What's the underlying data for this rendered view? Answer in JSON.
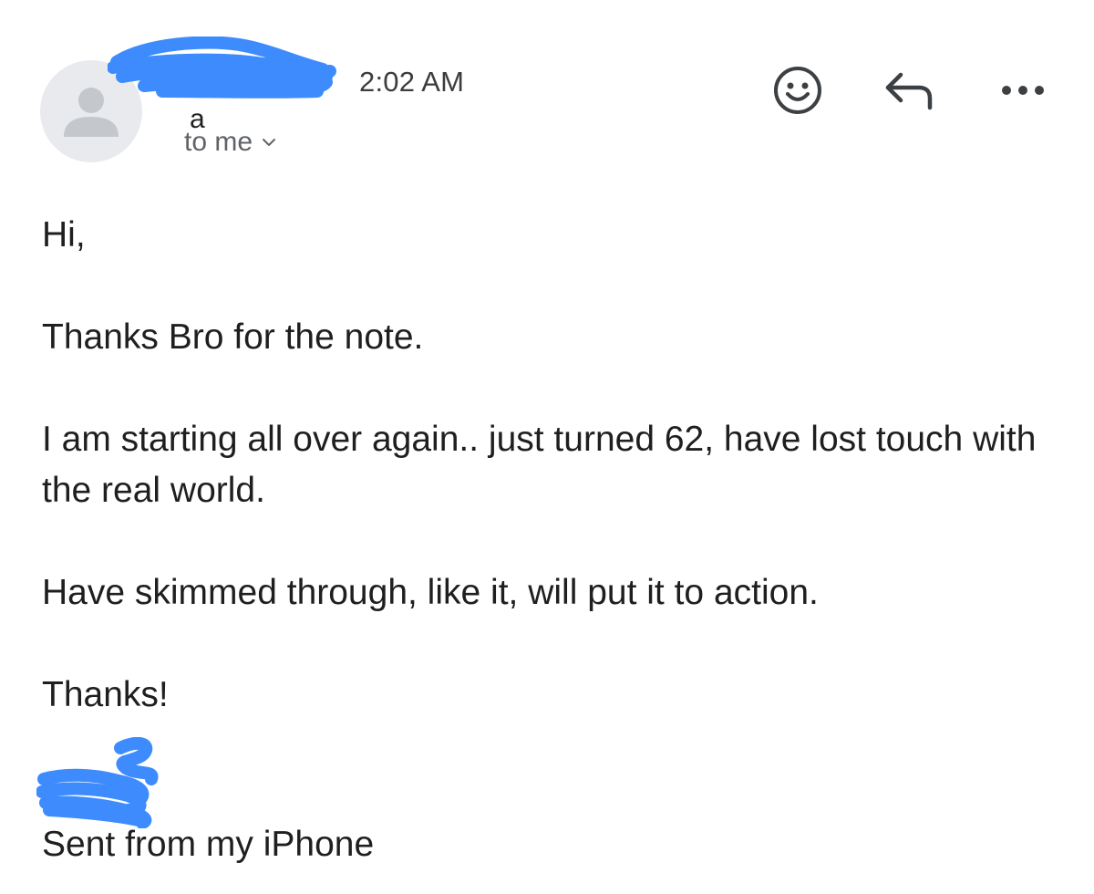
{
  "email": {
    "header": {
      "time": "2:02 AM",
      "recipient_label": "to me",
      "sender_name_partial": "a",
      "avatar_icon": "person-icon",
      "actions": [
        {
          "icon": "smiley-icon",
          "label": "React"
        },
        {
          "icon": "reply-icon",
          "label": "Reply"
        },
        {
          "icon": "more-horizontal-icon",
          "label": "More"
        }
      ],
      "redaction_color": "#3d8bfd"
    },
    "body": {
      "greeting": "Hi,",
      "paragraph_1": "Thanks Bro for the note.",
      "paragraph_2": "I am starting all over again.. just turned 62, have lost touch with the real world.",
      "paragraph_3": "Have skimmed through, like it, will put it to action.",
      "closing": "Thanks!"
    },
    "signature": {
      "sent_from": "Sent from my iPhone"
    }
  }
}
